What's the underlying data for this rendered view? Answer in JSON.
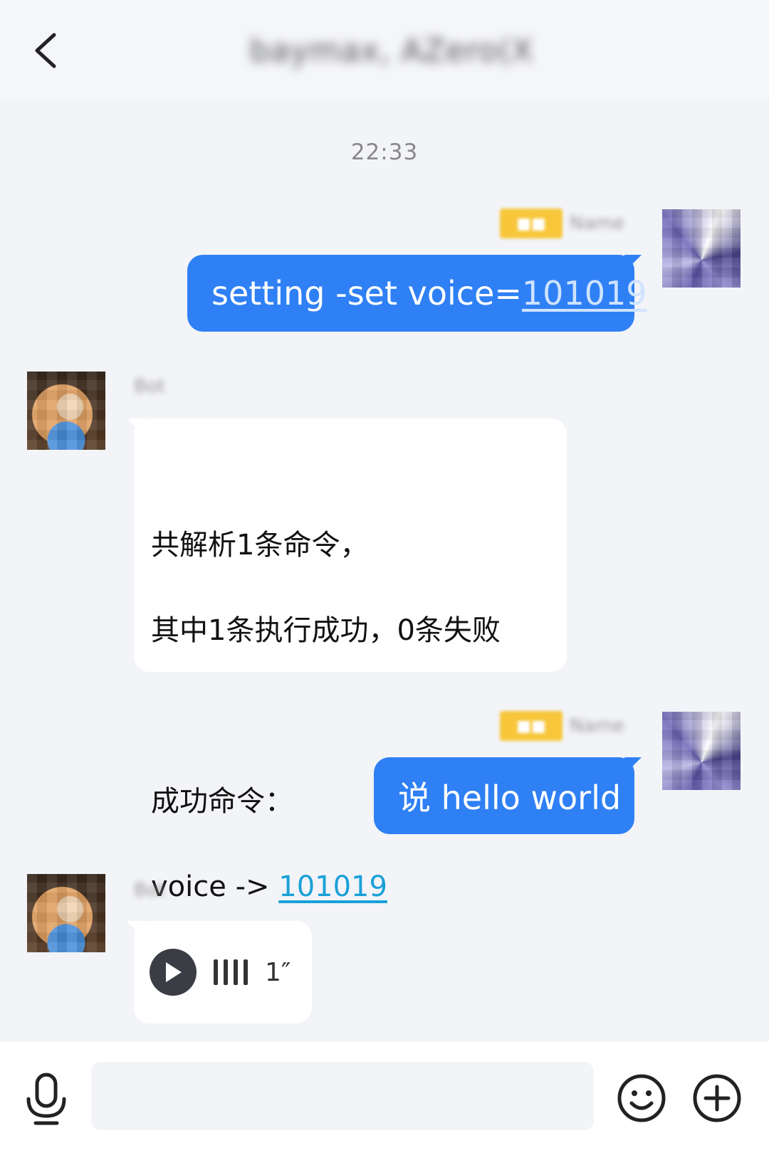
{
  "header": {
    "back_icon": "chevron-left-icon",
    "title": "baymax, AZero(X"
  },
  "timestamp": "22:33",
  "messages": [
    {
      "direction": "out",
      "badge": "■■",
      "sender": "Name",
      "text_prefix": "setting -set voice=",
      "text_link": "101019"
    },
    {
      "direction": "in",
      "sender": "Bot",
      "line1": "共解析1条命令，",
      "line2": "其中1条执行成功，0条失败",
      "line3": "成功命令：",
      "line4_prefix": "voice -> ",
      "line4_link": "101019"
    },
    {
      "direction": "out",
      "badge": "■■",
      "sender": "Name",
      "text": "说 hello world"
    },
    {
      "direction": "in",
      "sender": "Bot",
      "type": "voice",
      "duration": "1″"
    }
  ],
  "input_bar": {
    "mic_icon": "microphone-icon",
    "placeholder": "",
    "emoji_icon": "smiley-icon",
    "plus_icon": "plus-circle-icon"
  },
  "colors": {
    "bubble_out": "#2f80f5",
    "bubble_in": "#ffffff",
    "background": "#f3f4f8",
    "link_in": "#1aa0d8",
    "badge": "#f7c63a"
  }
}
